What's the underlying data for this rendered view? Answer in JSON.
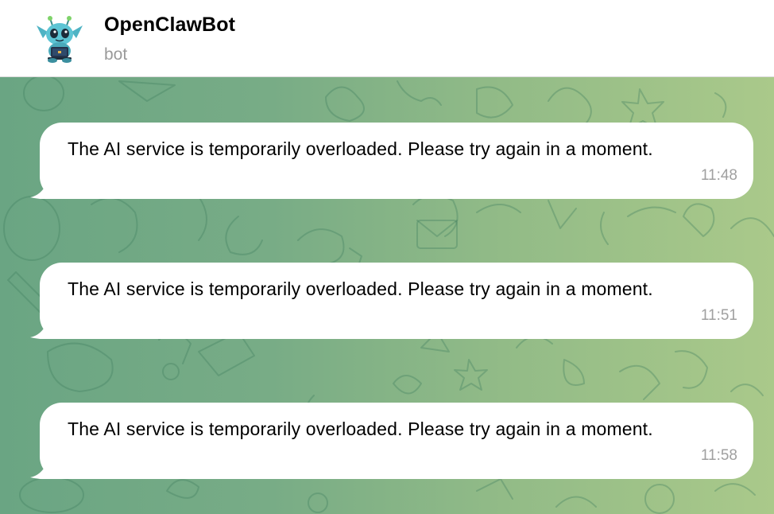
{
  "header": {
    "title": "OpenClawBot",
    "status": "bot",
    "avatar_icon": "alien-robot-avatar-icon"
  },
  "messages": [
    {
      "text": "The AI service is temporarily overloaded. Please try again in a moment.",
      "time": "11:48"
    },
    {
      "text": "The AI service is temporarily overloaded. Please try again in a moment.",
      "time": "11:51"
    },
    {
      "text": "The AI service is temporarily overloaded. Please try again in a moment.",
      "time": "11:58"
    }
  ],
  "colors": {
    "chat_background_left": "#6aa583",
    "chat_background_right": "#aac98a",
    "bubble": "#ffffff",
    "time_text": "#a0a0a0"
  }
}
